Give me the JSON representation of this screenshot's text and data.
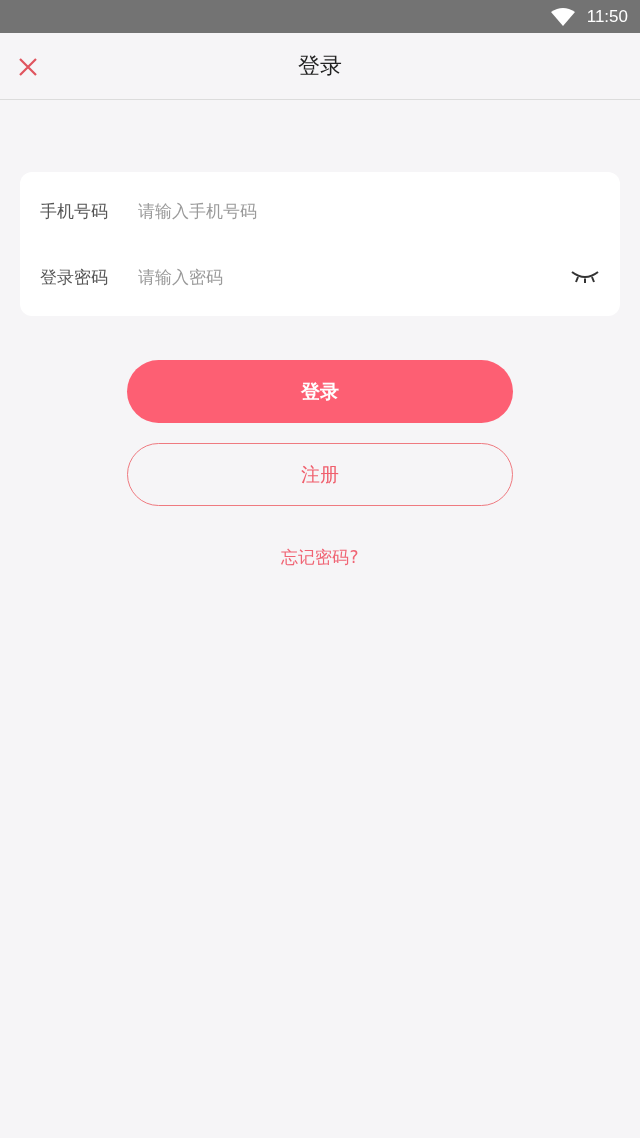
{
  "status_bar": {
    "time": "11:50"
  },
  "header": {
    "title": "登录"
  },
  "form": {
    "fields": [
      {
        "label": "手机号码",
        "placeholder": "请输入手机号码",
        "kind": "text"
      },
      {
        "label": "登录密码",
        "placeholder": "请输入密码",
        "kind": "password"
      }
    ]
  },
  "buttons": [
    {
      "label": "登录",
      "kind": "primary"
    },
    {
      "label": "注册",
      "kind": "outline"
    }
  ],
  "forgot_link": "忘记密码?"
}
